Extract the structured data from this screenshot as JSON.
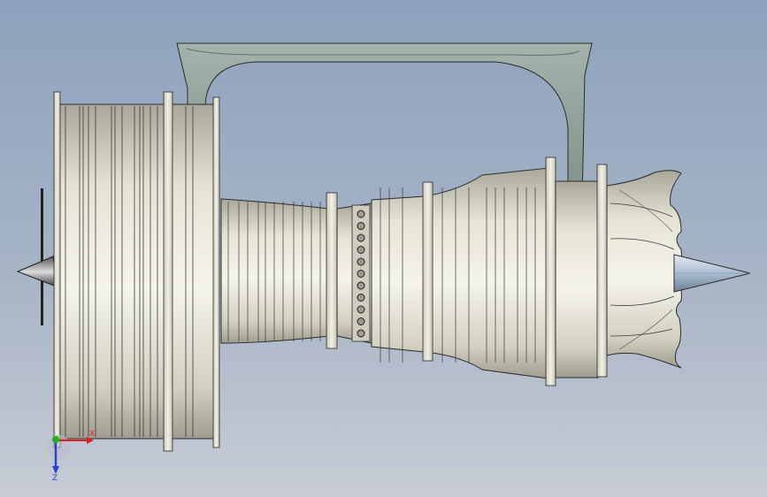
{
  "scene": {
    "model": "turbofan-engine",
    "view": "side",
    "colors": {
      "background_top": "#8ea2bd",
      "background_bottom": "#c7ccd5",
      "metal_light": "#f3f2e8",
      "metal_mid": "#d8d6c8",
      "metal_dark": "#a9a79a",
      "edge": "#2b2b2b",
      "pylon": "#8fa29a",
      "cone": "#b9c9d8"
    }
  },
  "triad": {
    "x_label": "X",
    "y_label": "Y",
    "z_label": "Z",
    "x_color": "#e02020",
    "y_color": "#22b022",
    "z_color": "#2a40d0"
  }
}
